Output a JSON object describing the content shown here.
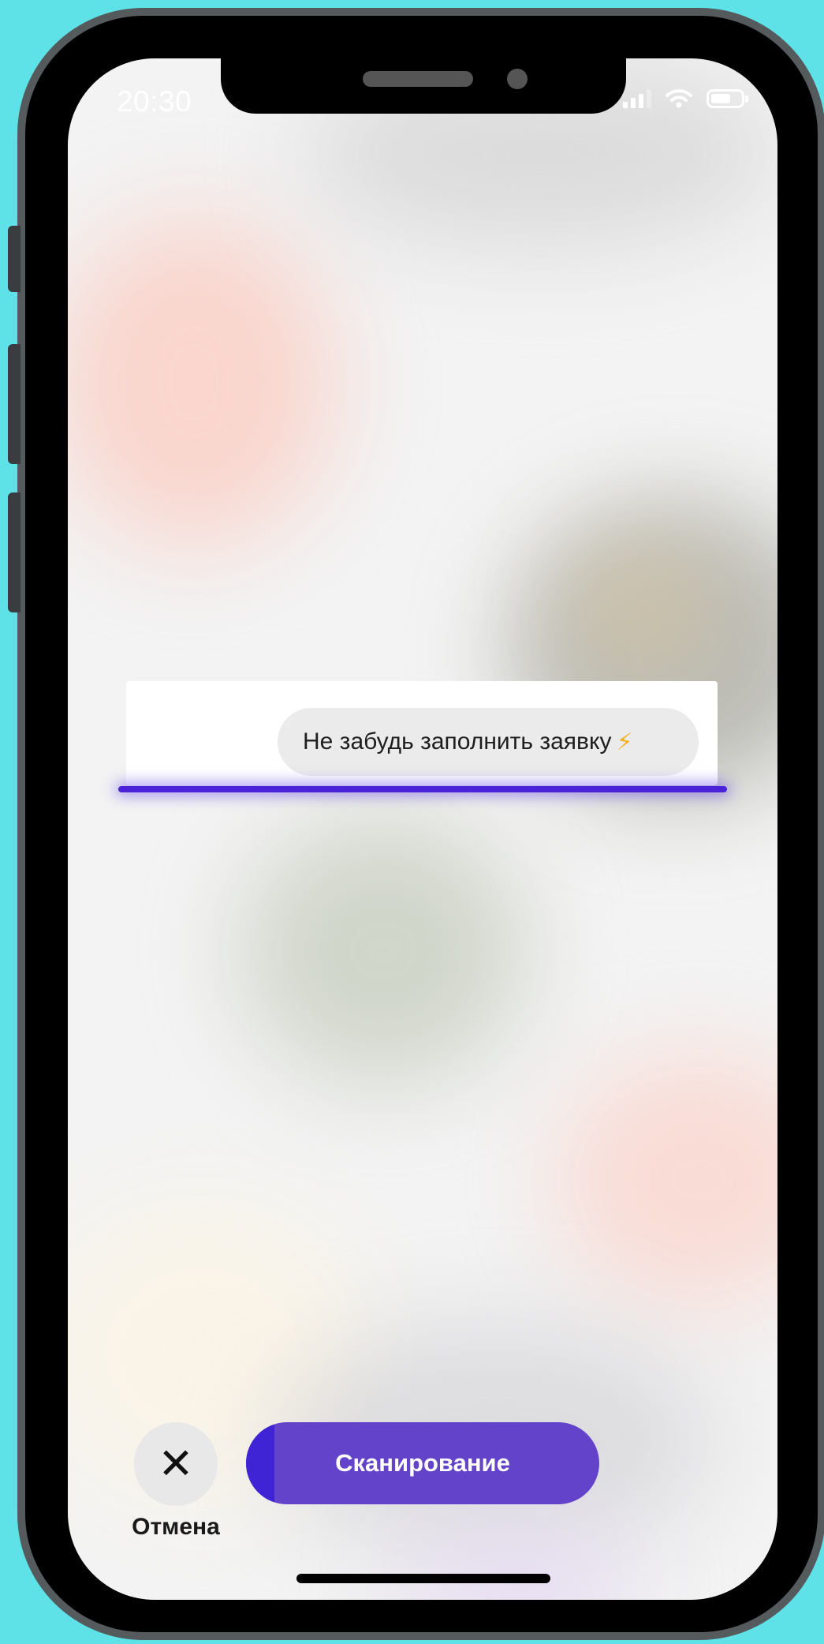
{
  "status_bar": {
    "time": "20:30",
    "signal_icon": "cellular-signal-icon",
    "wifi_icon": "wifi-icon",
    "battery_icon": "battery-icon",
    "battery_level": 0.55
  },
  "message": {
    "text": "Не забудь заполнить заявку",
    "emoji": "⚡"
  },
  "controls": {
    "cancel_icon": "close-icon",
    "cancel_glyph": "✕",
    "cancel_label": "Отмена",
    "scan_label": "Сканирование",
    "scan_progress": 0.08
  },
  "colors": {
    "background": "#5fe1e8",
    "accent": "#6243c9",
    "scan_line": "#4a23d9"
  }
}
